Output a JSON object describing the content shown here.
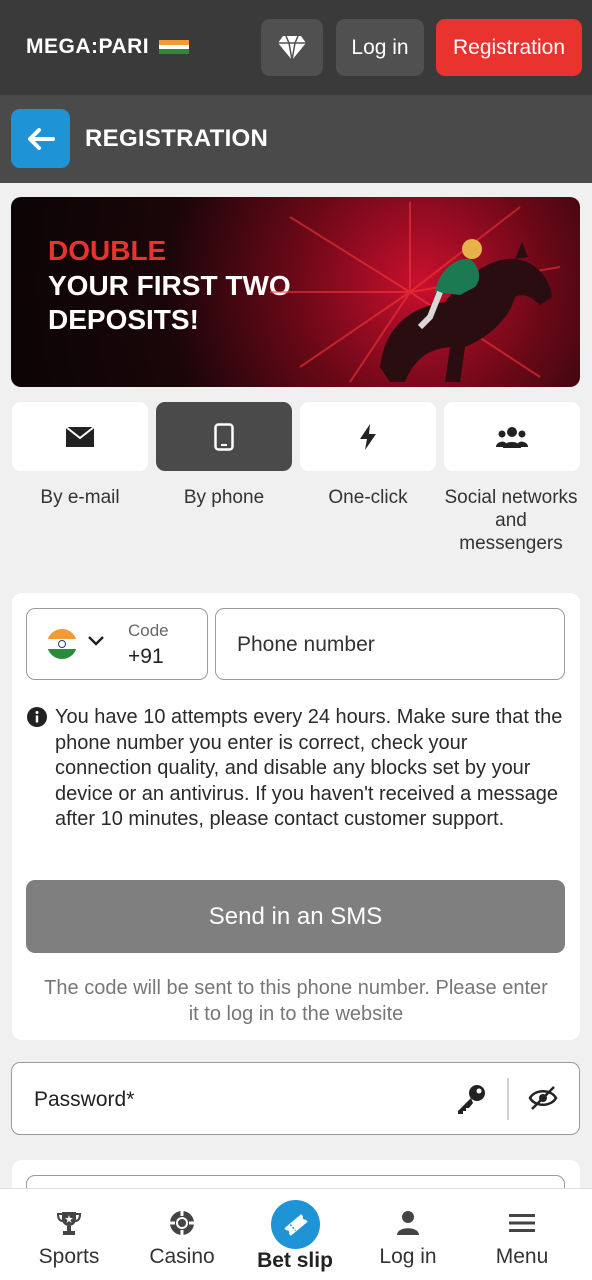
{
  "header": {
    "logo_text": "MEGA:PARI",
    "login_label": "Log in",
    "registration_label": "Registration"
  },
  "subheader": {
    "title": "REGISTRATION"
  },
  "banner": {
    "line1": "DOUBLE",
    "line2": "YOUR FIRST TWO DEPOSITS!"
  },
  "methods": [
    {
      "label": "By e-mail",
      "icon": "envelope-icon",
      "active": false
    },
    {
      "label": "By phone",
      "icon": "phone-icon",
      "active": true
    },
    {
      "label": "One-click",
      "icon": "lightning-icon",
      "active": false
    },
    {
      "label": "Social networks and messengers",
      "icon": "users-icon",
      "active": false
    }
  ],
  "phone_form": {
    "code_label": "Code",
    "code_value": "+91",
    "phone_placeholder": "Phone number",
    "info_text": "You have 10 attempts every 24 hours. Make sure that the phone number you enter is correct, check your connection quality, and disable any blocks set by your device or an antivirus. If you haven't received a message after 10 minutes, please contact customer support.",
    "sms_button": "Send in an SMS",
    "sms_note": "The code will be sent to this phone number. Please enter it to log in to the website"
  },
  "password": {
    "label": "Password*"
  },
  "bottom_nav": {
    "sports": "Sports",
    "casino": "Casino",
    "betslip": "Bet slip",
    "login": "Log in",
    "menu": "Menu"
  },
  "colors": {
    "accent_red": "#e8332f",
    "accent_blue": "#1e93d6",
    "header_bg": "#3a3a3a",
    "subheader_bg": "#4a4a4a"
  }
}
